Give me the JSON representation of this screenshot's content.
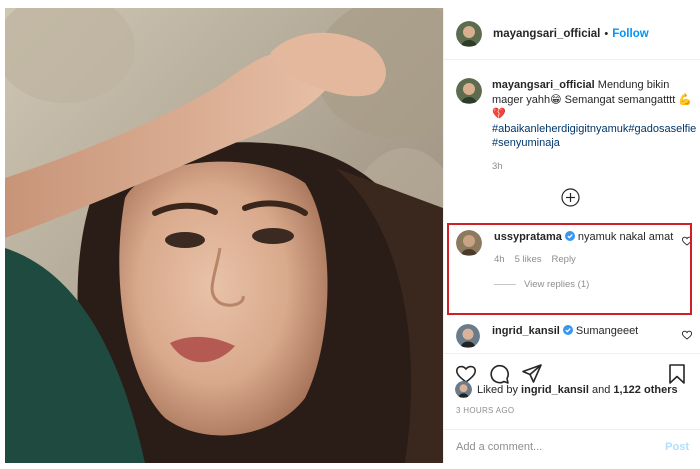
{
  "post": {
    "username": "mayangsari_official",
    "separator": "•",
    "follow_label": "Follow",
    "caption_username": "mayangsari_official",
    "caption_text": "Mendung bikin mager yahh😁 Semangat semangatttt 💪💔",
    "hashtags": "#abaikanleherdigigitnyamuk#gadosaselfie#senyuminaja",
    "caption_time": "3h"
  },
  "comments": [
    {
      "username": "ussypratama",
      "text": "nyamuk nakal amat",
      "time": "4h",
      "likes": "5 likes",
      "reply_label": "Reply",
      "view_replies": "View replies (1)",
      "verified": true,
      "highlighted": true
    },
    {
      "username": "ingrid_kansil",
      "text": "Sumangeeet",
      "verified": true
    }
  ],
  "actions": {
    "icons": [
      "heart-icon",
      "comment-icon",
      "share-icon",
      "bookmark-icon"
    ]
  },
  "likes": {
    "prefix": "Liked by",
    "user": "ingrid_kansil",
    "conjunction": "and",
    "others": "1,122 others"
  },
  "date": "3 HOURS AGO",
  "add_comment": {
    "placeholder": "Add a comment...",
    "post_label": "Post"
  },
  "colors": {
    "link_blue": "#0095f6",
    "hashtag": "#00376b",
    "verified": "#3897f0",
    "highlight_box": "#cf2027",
    "muted": "#8e8e8e"
  }
}
